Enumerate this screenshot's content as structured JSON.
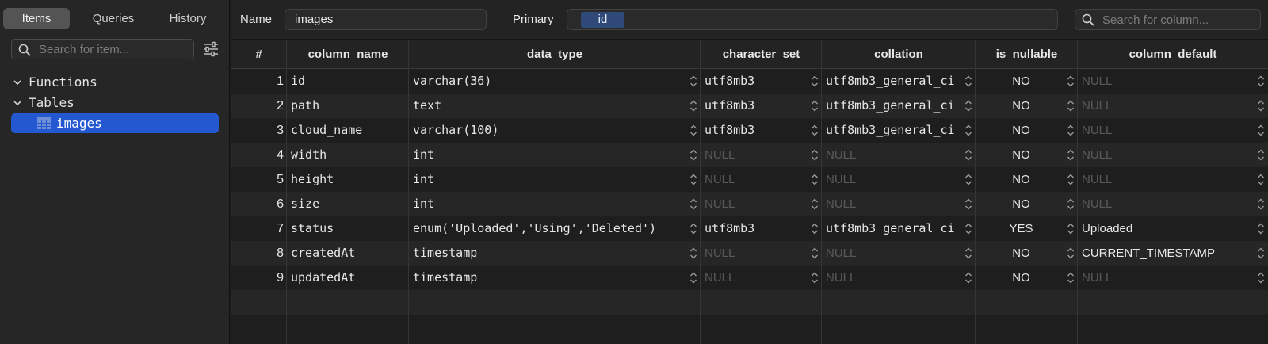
{
  "sidebar": {
    "tabs": [
      {
        "label": "Items",
        "active": true
      },
      {
        "label": "Queries",
        "active": false
      },
      {
        "label": "History",
        "active": false
      }
    ],
    "search": {
      "placeholder": "Search for item..."
    },
    "filter_icon": "sliders-icon",
    "tree": [
      {
        "label": "Functions",
        "icon": "chevron-down-icon"
      },
      {
        "label": "Tables",
        "icon": "chevron-down-icon"
      },
      {
        "label": "images",
        "icon": "table-icon",
        "selected": true
      }
    ]
  },
  "topbar": {
    "name_label": "Name",
    "name_value": "images",
    "primary_label": "Primary",
    "primary_tokens": [
      "id"
    ],
    "search": {
      "placeholder": "Search for column..."
    }
  },
  "table": {
    "columns": [
      "#",
      "column_name",
      "data_type",
      "character_set",
      "collation",
      "is_nullable",
      "column_default"
    ],
    "rows": [
      {
        "num": "1",
        "column_name": "id",
        "data_type": "varchar(36)",
        "character_set": "utf8mb3",
        "collation": "utf8mb3_general_ci",
        "is_nullable": "NO",
        "column_default": "NULL"
      },
      {
        "num": "2",
        "column_name": "path",
        "data_type": "text",
        "character_set": "utf8mb3",
        "collation": "utf8mb3_general_ci",
        "is_nullable": "NO",
        "column_default": "NULL"
      },
      {
        "num": "3",
        "column_name": "cloud_name",
        "data_type": "varchar(100)",
        "character_set": "utf8mb3",
        "collation": "utf8mb3_general_ci",
        "is_nullable": "NO",
        "column_default": "NULL"
      },
      {
        "num": "4",
        "column_name": "width",
        "data_type": "int",
        "character_set": "NULL",
        "collation": "NULL",
        "is_nullable": "NO",
        "column_default": "NULL"
      },
      {
        "num": "5",
        "column_name": "height",
        "data_type": "int",
        "character_set": "NULL",
        "collation": "NULL",
        "is_nullable": "NO",
        "column_default": "NULL"
      },
      {
        "num": "6",
        "column_name": "size",
        "data_type": "int",
        "character_set": "NULL",
        "collation": "NULL",
        "is_nullable": "NO",
        "column_default": "NULL"
      },
      {
        "num": "7",
        "column_name": "status",
        "data_type": "enum('Uploaded','Using','Deleted')",
        "character_set": "utf8mb3",
        "collation": "utf8mb3_general_ci",
        "is_nullable": "YES",
        "column_default": "Uploaded"
      },
      {
        "num": "8",
        "column_name": "createdAt",
        "data_type": "timestamp",
        "character_set": "NULL",
        "collation": "NULL",
        "is_nullable": "NO",
        "column_default": "CURRENT_TIMESTAMP"
      },
      {
        "num": "9",
        "column_name": "updatedAt",
        "data_type": "timestamp",
        "character_set": "NULL",
        "collation": "NULL",
        "is_nullable": "NO",
        "column_default": "NULL"
      }
    ]
  },
  "colors": {
    "selection": "#2458d0",
    "primary_token": "#2f4a78",
    "null_text": "#5a5a5a"
  }
}
